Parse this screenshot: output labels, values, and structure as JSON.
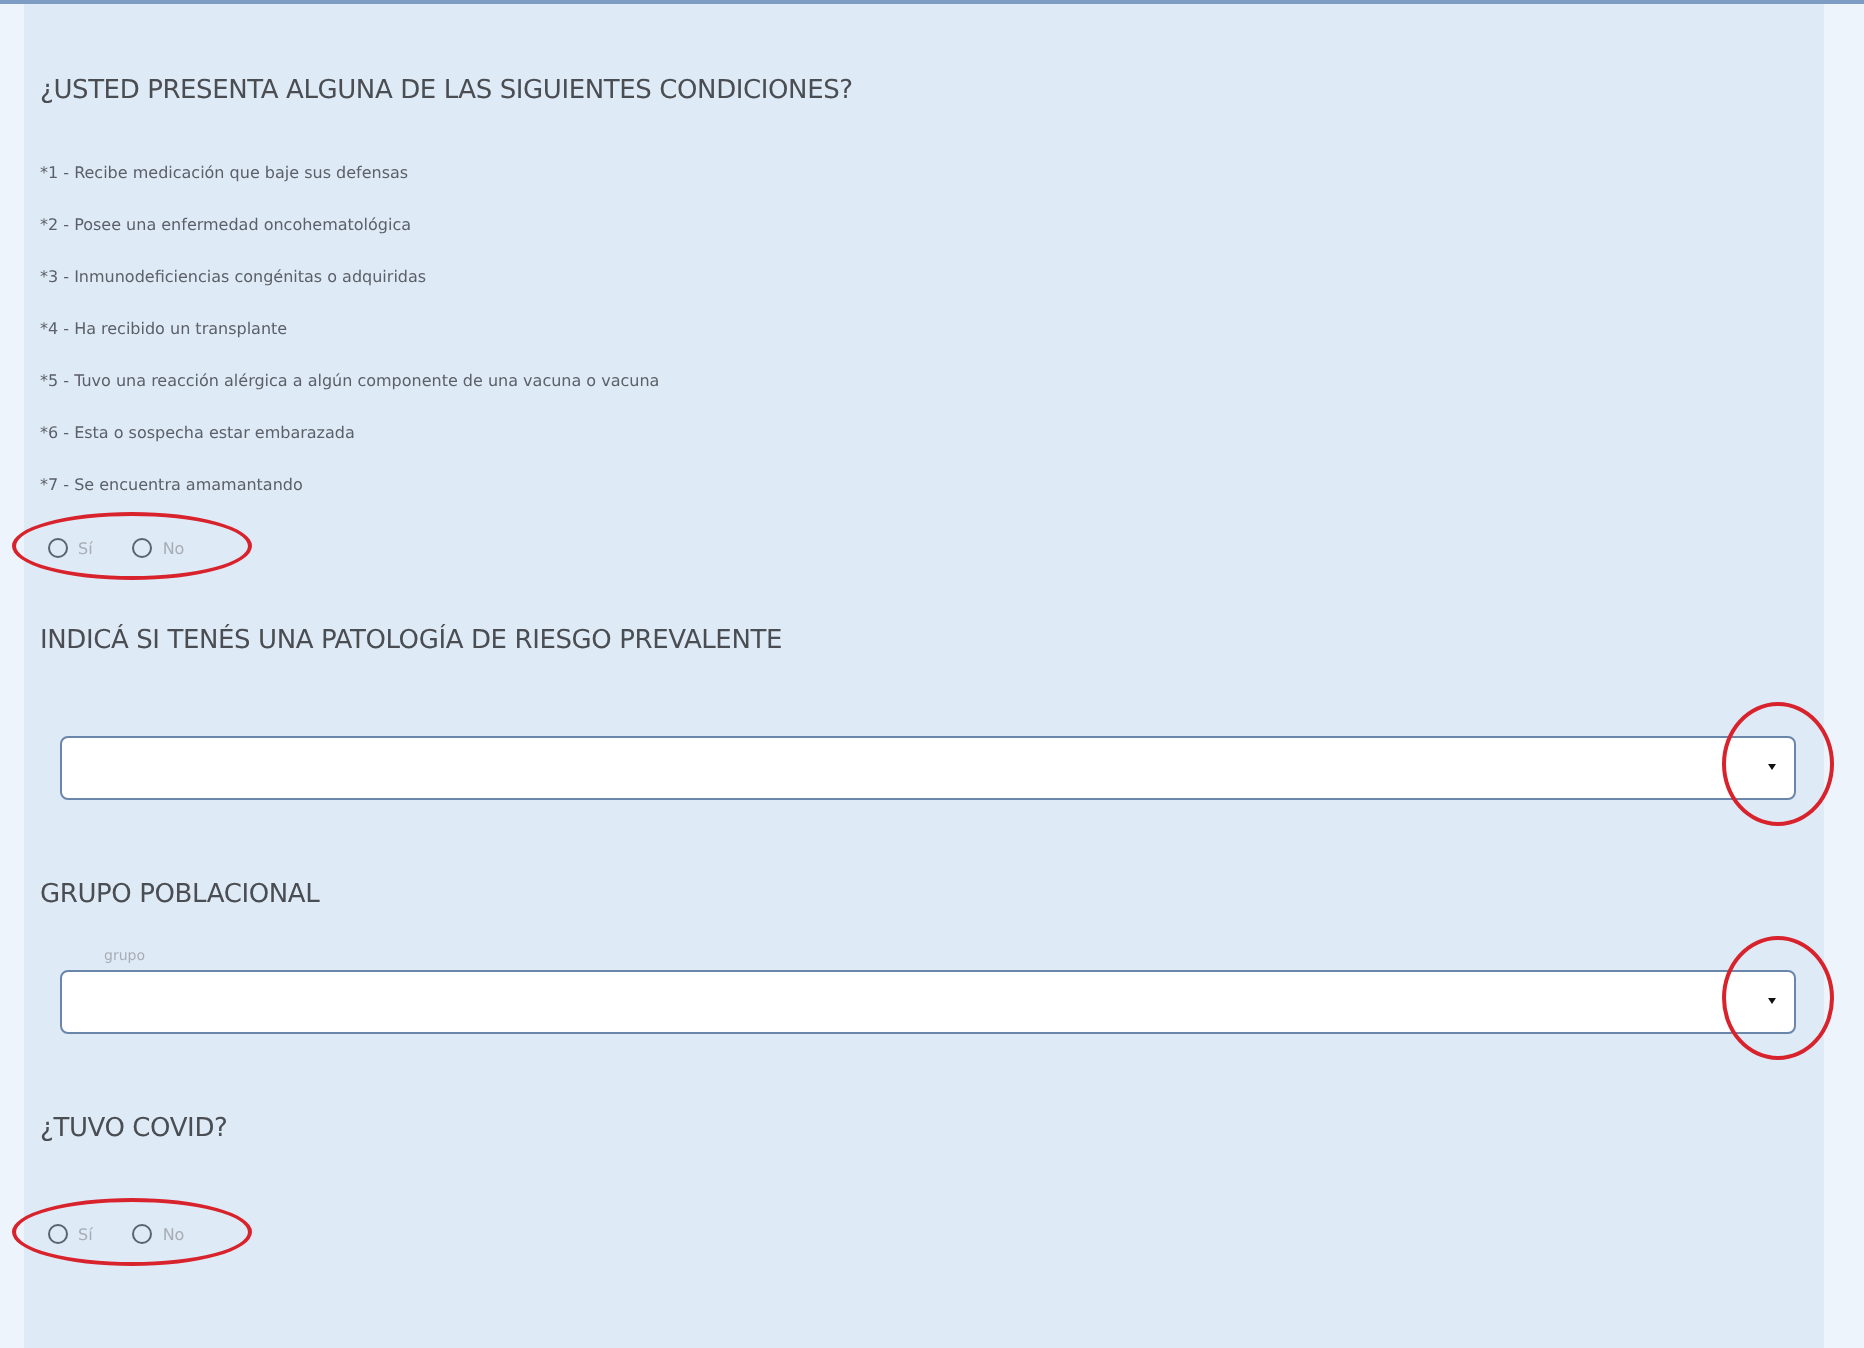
{
  "sections": [
    {
      "kind": "radio",
      "title": "¿USTED PRESENTA ALGUNA DE LAS SIGUIENTES CONDICIONES?",
      "notes": [
        "*1 - Recibe medicación que baje sus defensas",
        "*2 - Posee una enfermedad oncohematológica",
        "*3 - Inmunodeficiencias congénitas o adquiridas",
        "*4 - Ha recibido un transplante",
        "*5 - Tuvo una reacción alérgica a algún componente de una vacuna o vacuna",
        "*6 - Esta o sospecha estar embarazada",
        "*7 - Se encuentra amamantando"
      ],
      "options": [
        {
          "label": "Sí",
          "selected": false
        },
        {
          "label": "No",
          "selected": false
        }
      ],
      "highlighted": true
    },
    {
      "kind": "select",
      "title": "INDICÁ SI TENÉS UNA PATOLOGÍA DE RIESGO PREVALENTE",
      "highlighted": true
    },
    {
      "kind": "select",
      "title": "GRUPO POBLACIONAL",
      "field_label": "grupo",
      "highlighted": true
    },
    {
      "kind": "radio",
      "title": "¿TUVO COVID?",
      "options": [
        {
          "label": "Sí",
          "selected": false
        },
        {
          "label": "No",
          "selected": false
        }
      ],
      "highlighted": true
    }
  ]
}
